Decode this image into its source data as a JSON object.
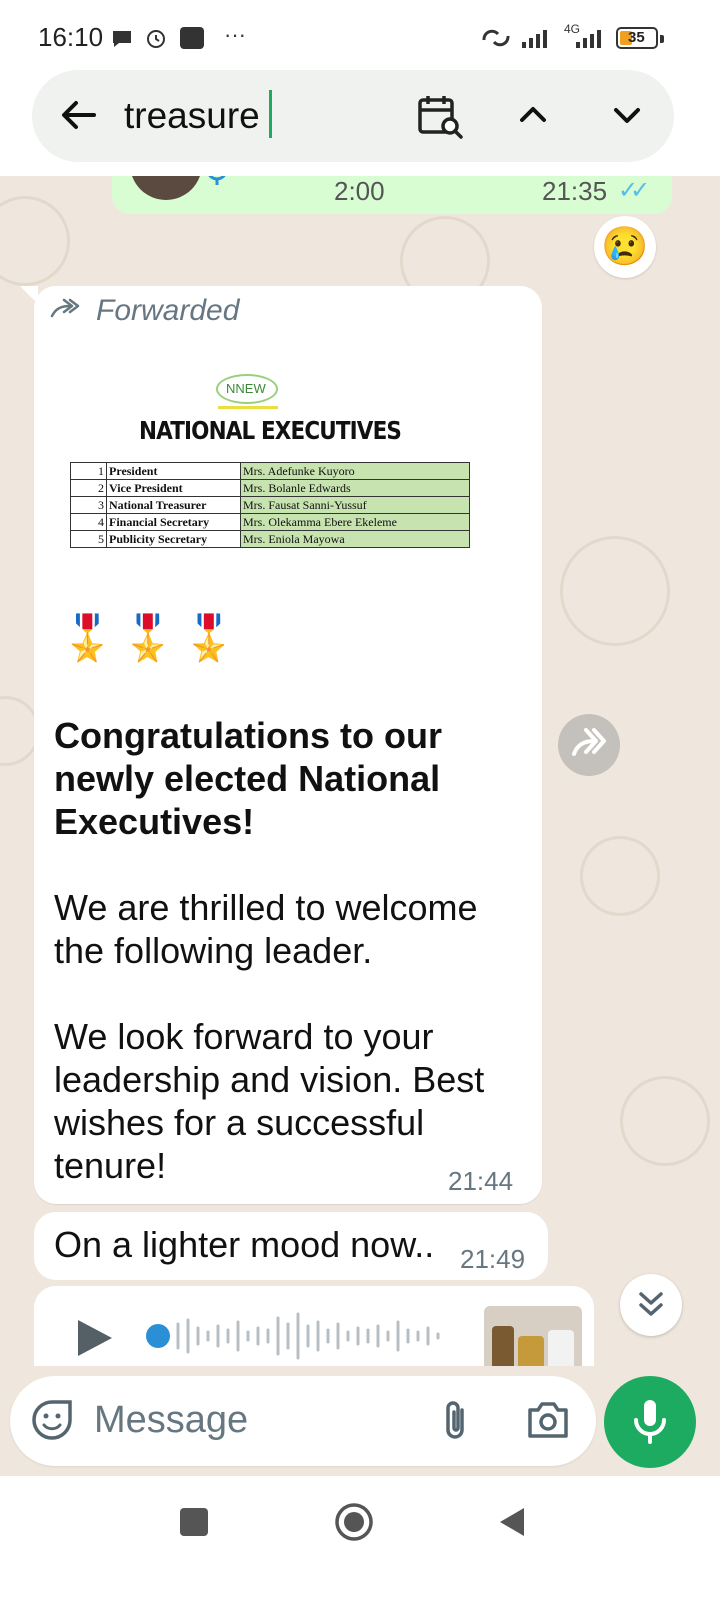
{
  "status_bar": {
    "time": "16:10",
    "more": "···",
    "network": "4G",
    "battery": "35"
  },
  "search": {
    "query": "treasure"
  },
  "voice_note_top": {
    "duration": "2:00",
    "time": "21:35",
    "ticks": "✓✓"
  },
  "reaction": {
    "emoji": "😢"
  },
  "forwarded_message": {
    "forwarded_label": "Forwarded",
    "image": {
      "logo_text": "NNEW",
      "title": "NATIONAL EXECUTIVES",
      "rows": [
        {
          "no": "1",
          "role": "President",
          "name": "Mrs. Adefunke Kuyoro"
        },
        {
          "no": "2",
          "role": "Vice President",
          "name": "Mrs. Bolanle Edwards"
        },
        {
          "no": "3",
          "role": "National Treasurer",
          "name": "Mrs.  Fausat Sanni-Yussuf"
        },
        {
          "no": "4",
          "role": "Financial Secretary",
          "name": "Mrs. Olekamma Ebere Ekeleme"
        },
        {
          "no": "5",
          "role": "Publicity Secretary",
          "name": "Mrs. Eniola Mayowa"
        }
      ]
    },
    "medals": "🎖️🎖️🎖️",
    "heading": "Congratulations to our newly elected National Executives!",
    "para1": "We are thrilled to welcome the following leader.",
    "para2": "We look forward to your leadership and vision. Best wishes for a successful tenure!",
    "time": "21:44"
  },
  "message_2": {
    "text": "On a lighter mood now..",
    "time": "21:49"
  },
  "composer": {
    "placeholder": "Message"
  },
  "colors": {
    "accent_green": "#1daa61",
    "outgoing_bubble": "#d9fdd3",
    "chat_background": "#efe7dd",
    "read_ticks": "#53bdeb"
  },
  "icons": {
    "back": "arrow-left-icon",
    "calendar": "calendar-search-icon",
    "up": "chevron-up-icon",
    "down": "chevron-down-icon",
    "forward": "forwarded-icon",
    "share": "share-forward-icon",
    "play": "play-icon",
    "scroll": "double-chevron-down-icon",
    "sticker": "sticker-icon",
    "attach": "paperclip-icon",
    "camera": "camera-icon",
    "mic": "microphone-icon"
  }
}
